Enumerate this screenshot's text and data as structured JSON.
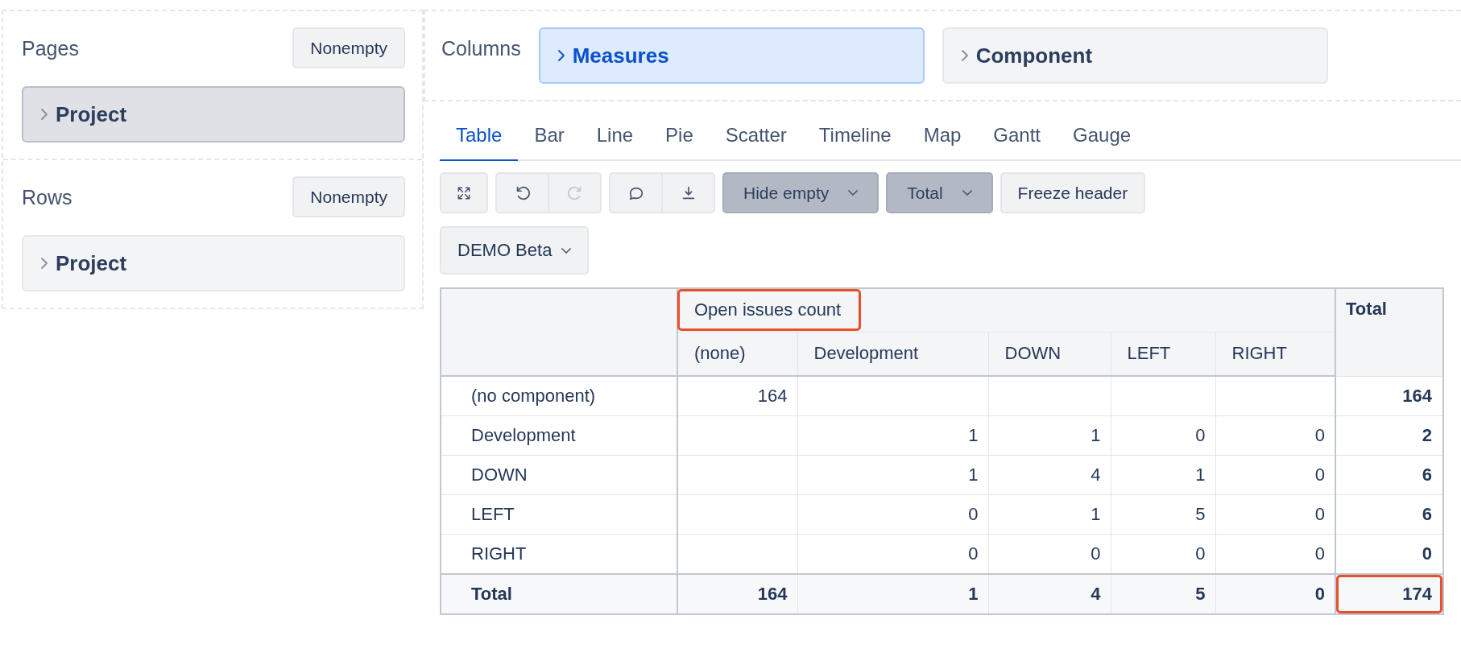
{
  "pages": {
    "title": "Pages",
    "button": "Nonempty",
    "items": [
      {
        "label": "Project",
        "selected": true
      }
    ]
  },
  "rows": {
    "title": "Rows",
    "button": "Nonempty",
    "items": [
      {
        "label": "Project",
        "selected": false
      }
    ]
  },
  "columns": {
    "title": "Columns",
    "items": [
      {
        "label": "Measures",
        "selected": true
      },
      {
        "label": "Component",
        "selected": false
      }
    ]
  },
  "tabs": [
    {
      "label": "Table",
      "selected": true
    },
    {
      "label": "Bar",
      "selected": false
    },
    {
      "label": "Line",
      "selected": false
    },
    {
      "label": "Pie",
      "selected": false
    },
    {
      "label": "Scatter",
      "selected": false
    },
    {
      "label": "Timeline",
      "selected": false
    },
    {
      "label": "Map",
      "selected": false
    },
    {
      "label": "Gantt",
      "selected": false
    },
    {
      "label": "Gauge",
      "selected": false
    }
  ],
  "toolbar": {
    "undo_disabled": false,
    "redo_disabled": true,
    "dropdowns": [
      {
        "label": "Hide empty",
        "active": true
      },
      {
        "label": "Total",
        "active": true
      }
    ],
    "buttons": [
      "Freeze header"
    ]
  },
  "filter": {
    "label": "DEMO Beta"
  },
  "table": {
    "measure": {
      "label": "Open issues count",
      "highlighted": true
    },
    "total_label": "Total",
    "columns": [
      "(none)",
      "Development",
      "DOWN",
      "LEFT",
      "RIGHT"
    ],
    "rows": [
      {
        "label": "(no component)",
        "cells": [
          "164",
          null,
          null,
          null,
          null
        ],
        "total": "164"
      },
      {
        "label": "Development",
        "cells": [
          null,
          "1",
          "1",
          "0",
          "0"
        ],
        "total": "2"
      },
      {
        "label": "DOWN",
        "cells": [
          null,
          "1",
          "4",
          "1",
          "0"
        ],
        "total": "6"
      },
      {
        "label": "LEFT",
        "cells": [
          null,
          "0",
          "1",
          "5",
          "0"
        ],
        "total": "6"
      },
      {
        "label": "RIGHT",
        "cells": [
          null,
          "0",
          "0",
          "0",
          "0"
        ],
        "total": "0"
      }
    ],
    "footer": {
      "label": "Total",
      "cells": [
        "164",
        "1",
        "4",
        "5",
        "0"
      ],
      "total": "174",
      "highlighted": true
    }
  }
}
